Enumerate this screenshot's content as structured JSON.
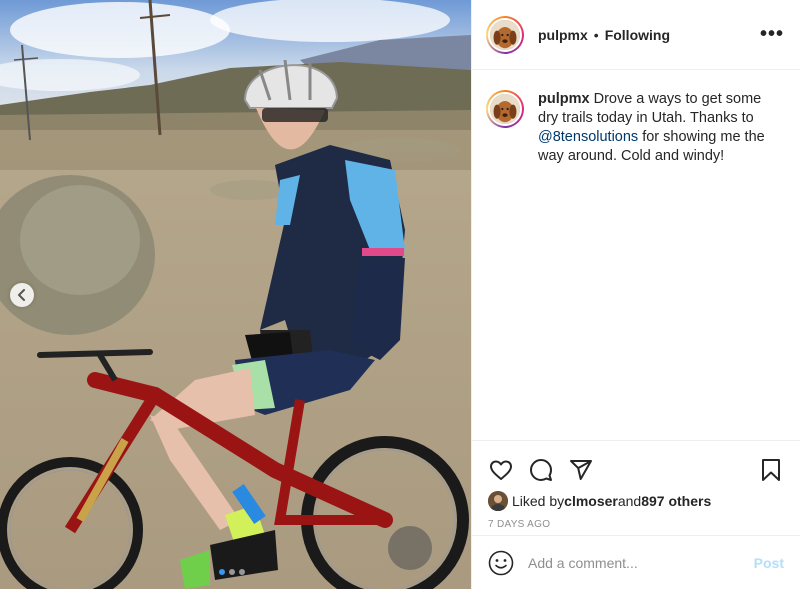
{
  "post": {
    "username": "pulpmx",
    "separator": "•",
    "follow_label": "Following",
    "more_label": "•••",
    "caption": {
      "username": "pulpmx",
      "text_before": " Drove a ways to get some dry trails today in Utah. Thanks to ",
      "mention": "@8tensolutions",
      "text_after": " for showing me the way around. Cold and windy!"
    },
    "likes": {
      "prefix": "Liked by ",
      "user": "clmoser",
      "middle": " and ",
      "count": "897 others"
    },
    "timestamp": "7 DAYS AGO",
    "comment": {
      "placeholder": "Add a comment...",
      "post_label": "Post"
    }
  },
  "icons": {
    "prev": "chevron-left-icon",
    "like": "heart-icon",
    "comment": "comment-icon",
    "share": "send-icon",
    "save": "bookmark-icon",
    "emoji": "emoji-icon"
  },
  "carousel": {
    "total": 3,
    "active_index": 0
  },
  "colors": {
    "link": "#00376b",
    "post_disabled": "#b2dffc",
    "active_dot": "#3897f0",
    "muted": "#8e8e8e"
  }
}
